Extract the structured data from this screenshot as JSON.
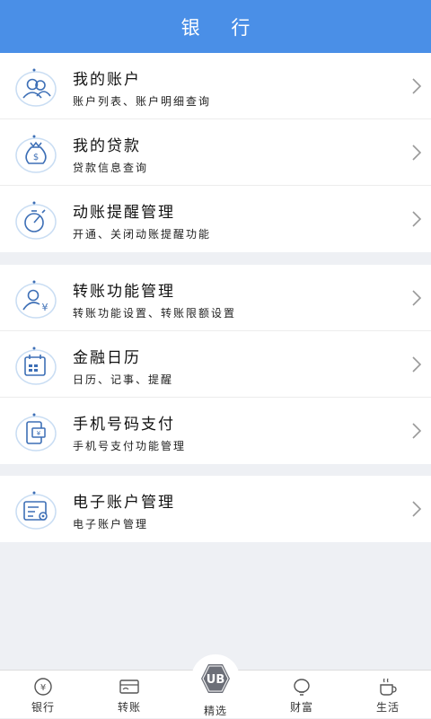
{
  "header": {
    "title": "银 行"
  },
  "groups": [
    {
      "items": [
        {
          "title": "我的账户",
          "subtitle": "账户列表、账户明细查询",
          "icon": "account-icon"
        },
        {
          "title": "我的贷款",
          "subtitle": "贷款信息查询",
          "icon": "money-bag-icon"
        },
        {
          "title": "动账提醒管理",
          "subtitle": "开通、关闭动账提醒功能",
          "icon": "timer-icon"
        }
      ]
    },
    {
      "items": [
        {
          "title": "转账功能管理",
          "subtitle": "转账功能设置、转账限额设置",
          "icon": "transfer-user-icon"
        },
        {
          "title": "金融日历",
          "subtitle": "日历、记事、提醒",
          "icon": "calendar-icon"
        },
        {
          "title": "手机号码支付",
          "subtitle": "手机号支付功能管理",
          "icon": "phone-pay-icon"
        }
      ]
    },
    {
      "items": [
        {
          "title": "电子账户管理",
          "subtitle": "电子账户管理",
          "icon": "e-account-settings-icon"
        }
      ]
    }
  ],
  "tabbar": {
    "tabs": [
      {
        "label": "银行",
        "icon": "yuan-circle-icon"
      },
      {
        "label": "转账",
        "icon": "card-icon"
      },
      {
        "label": "精选",
        "icon": "ub-logo-icon",
        "logo_text": "UB"
      },
      {
        "label": "财富",
        "icon": "lightbulb-icon"
      },
      {
        "label": "生活",
        "icon": "coffee-cup-icon"
      }
    ]
  },
  "colors": {
    "header_bg": "#4a8fe7",
    "icon_line": "#3d6fb6",
    "icon_circle": "#c9ddf3"
  }
}
